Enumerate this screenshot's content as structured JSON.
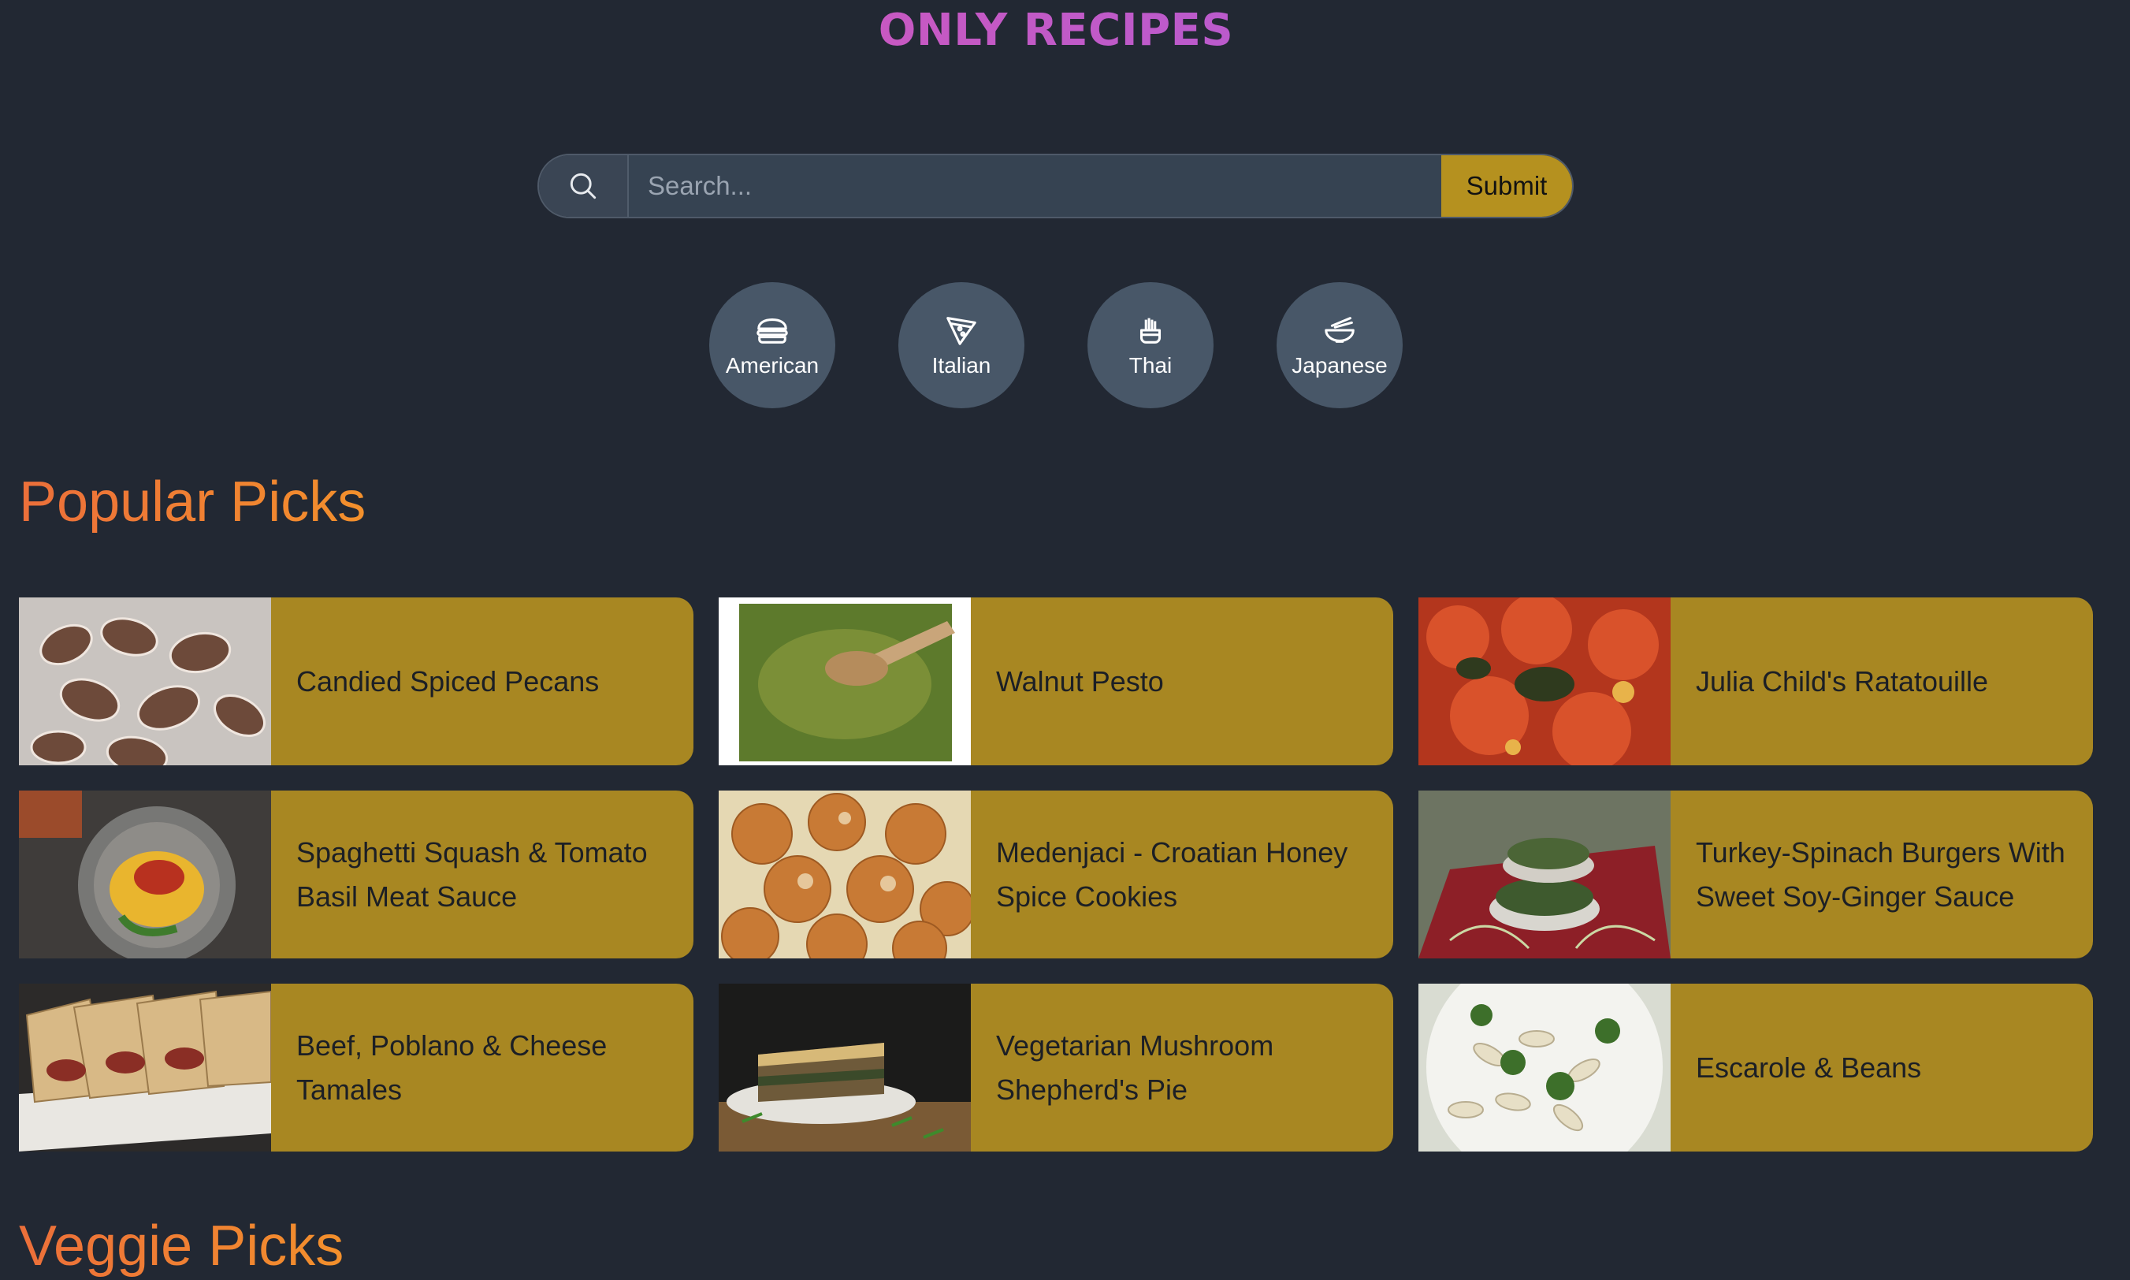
{
  "app": {
    "brand": "ONLY RECIPES"
  },
  "search": {
    "placeholder": "Search...",
    "value": "",
    "submit_label": "Submit"
  },
  "cuisines": [
    {
      "label": "American",
      "icon": "burger-icon"
    },
    {
      "label": "Italian",
      "icon": "pizza-icon"
    },
    {
      "label": "Thai",
      "icon": "noodles-icon"
    },
    {
      "label": "Japanese",
      "icon": "ramen-bowl-icon"
    }
  ],
  "sections": {
    "popular": {
      "title": "Popular Picks"
    },
    "veggie": {
      "title": "Veggie Picks"
    }
  },
  "recipes": [
    {
      "title": "Candied Spiced Pecans"
    },
    {
      "title": "Walnut Pesto"
    },
    {
      "title": "Julia Child's Ratatouille"
    },
    {
      "title": "Spaghetti Squash & Tomato Basil Meat Sauce"
    },
    {
      "title": "Medenjaci - Croatian Honey Spice Cookies"
    },
    {
      "title": "Turkey-Spinach Burgers With Sweet Soy-Ginger Sauce"
    },
    {
      "title": "Beef, Poblano & Cheese Tamales"
    },
    {
      "title": "Vegetarian Mushroom Shepherd's Pie"
    },
    {
      "title": "Escarole & Beans"
    }
  ],
  "colors": {
    "background": "#222833",
    "card": "#a88722",
    "submit": "#b5911f",
    "cuisine_bubble": "#485768",
    "brand_gradient_start": "#e754a8",
    "brand_gradient_end": "#9b5fe6",
    "section_title": "#f07b30"
  }
}
